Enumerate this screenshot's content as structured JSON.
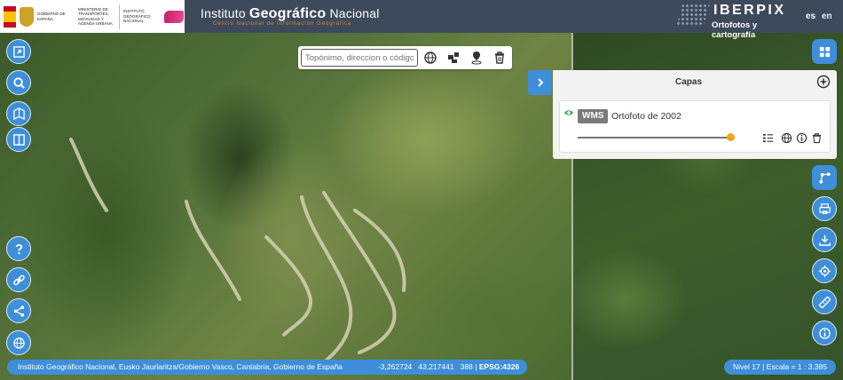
{
  "header": {
    "gov_text_1": "Gobierno de España",
    "gov_text_2": "Ministerio de Transportes, Movilidad y Agenda Urbana",
    "gov_text_3": "Instituto Geográfico Nacional",
    "title_pre": "Instituto ",
    "title_bold": "Geográfico",
    "title_post": " Nacional",
    "subtitle": "Centro Nacional de Información Geográfica",
    "app_name": "IBERPIX",
    "app_tagline": "Ortofotos y cartografía",
    "lang_es": "es",
    "lang_en": "en"
  },
  "search": {
    "placeholder": "Topónimo, direccion o código"
  },
  "layers_panel": {
    "title": "Capas",
    "layer": {
      "type_badge": "WMS",
      "name": "Ortofoto de 2002",
      "opacity": 1.0
    }
  },
  "footer": {
    "attribution": "Instituto Geográfico Nacional,  Eusko Jaurlaritza/Gobierno Vasco,  Cantabria, Gobierno de España",
    "lon": "-3,262724",
    "lat": "43,217441",
    "alt": "388",
    "sep": "|",
    "epsg": "EPSG:4326",
    "scale": "Nivel 17  |  Escala = 1 : 3.385"
  },
  "icons": {
    "left": [
      "home-extent-icon",
      "search-icon",
      "map-book-icon",
      "split-view-icon",
      "help-icon",
      "link-icon",
      "share-icon",
      "globe-icon"
    ],
    "right": [
      "apps-grid-icon",
      "route-icon",
      "print-icon",
      "download-icon",
      "locate-icon",
      "measure-icon",
      "info-icon"
    ]
  },
  "colors": {
    "header_bg": "#3d4a5c",
    "accent": "#3e8ed9",
    "slider_handle": "#f4a21a",
    "ign_orange": "#e08a2a"
  }
}
